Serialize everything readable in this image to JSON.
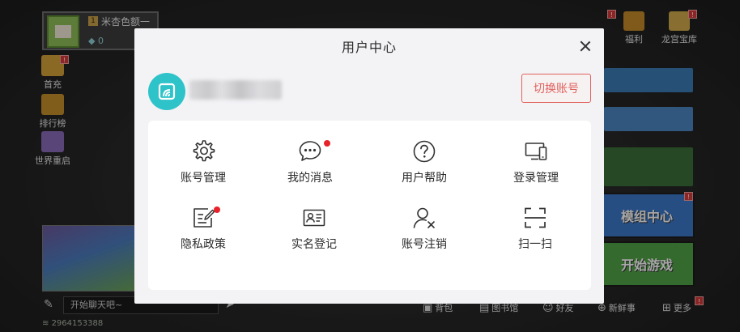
{
  "background": {
    "profile": {
      "name": "米杏色额一",
      "level": "1",
      "coins": "0"
    },
    "sidebar": [
      {
        "label": "首充",
        "badge": "!"
      },
      {
        "label": "排行榜",
        "badge": ""
      },
      {
        "label": "世界重启",
        "badge": ""
      }
    ],
    "top_right": [
      {
        "label": "福利",
        "badge": "!"
      },
      {
        "label": "龙宫宝库",
        "badge": "!"
      }
    ],
    "mod_center_label": "模组中心",
    "start_game_label": "开始游戏",
    "chat_placeholder": "开始聊天吧~",
    "room_id": "2964153388",
    "bottom_bar": [
      {
        "label": "背包"
      },
      {
        "label": "图书馆"
      },
      {
        "label": "好友"
      },
      {
        "label": "新鲜事"
      },
      {
        "label": "更多"
      }
    ]
  },
  "modal": {
    "title": "用户中心",
    "switch_account_label": "切换账号",
    "items": [
      {
        "label": "账号管理",
        "icon": "gear-icon",
        "has_dot": false
      },
      {
        "label": "我的消息",
        "icon": "message-icon",
        "has_dot": true
      },
      {
        "label": "用户帮助",
        "icon": "help-icon",
        "has_dot": false
      },
      {
        "label": "登录管理",
        "icon": "devices-icon",
        "has_dot": false
      },
      {
        "label": "隐私政策",
        "icon": "privacy-edit-icon",
        "has_dot": true
      },
      {
        "label": "实名登记",
        "icon": "id-card-icon",
        "has_dot": false
      },
      {
        "label": "账号注销",
        "icon": "user-remove-icon",
        "has_dot": false
      },
      {
        "label": "扫一扫",
        "icon": "scan-icon",
        "has_dot": false
      }
    ]
  },
  "colors": {
    "accent_red": "#e0615d",
    "avatar_teal": "#2ec3c9",
    "notification_dot": "#e8222b"
  }
}
